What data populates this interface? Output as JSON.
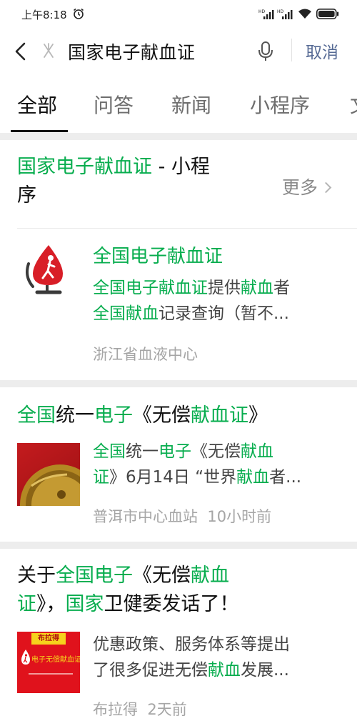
{
  "status_bar": {
    "time": "上午8:18",
    "signal1_label": "HD",
    "signal2_label": "HD"
  },
  "search": {
    "query": "国家电子献血证",
    "cancel_label": "取消"
  },
  "tabs": [
    {
      "label": "全部",
      "active": true
    },
    {
      "label": "问答",
      "active": false
    },
    {
      "label": "新闻",
      "active": false
    },
    {
      "label": "小程序",
      "active": false
    },
    {
      "label": "文",
      "active": false
    }
  ],
  "mini_program_section": {
    "title_highlight": "国家电子献血证",
    "title_rest_line1": " - 小程",
    "title_line2": "序",
    "more_label": "更多",
    "item": {
      "name": "全国电子献血证",
      "snippet_line1": [
        {
          "text": "全国电子献血证",
          "hl": true
        },
        {
          "text": "提供",
          "hl": false
        },
        {
          "text": "献血",
          "hl": true
        },
        {
          "text": "者",
          "hl": false
        }
      ],
      "snippet_line2": [
        {
          "text": "全国献血",
          "hl": true
        },
        {
          "text": "记录查询（暂不...",
          "hl": false
        }
      ],
      "source": "浙江省血液中心"
    }
  },
  "articles": [
    {
      "title_lines": [
        [
          {
            "text": "全国",
            "hl": true
          },
          {
            "text": "统一",
            "hl": false
          },
          {
            "text": "电子",
            "hl": true
          },
          {
            "text": "《无偿",
            "hl": false
          },
          {
            "text": "献血证",
            "hl": true
          },
          {
            "text": "》",
            "hl": false
          }
        ]
      ],
      "snippet_lines": [
        [
          {
            "text": "全国",
            "hl": true
          },
          {
            "text": "统一",
            "hl": false
          },
          {
            "text": "电子",
            "hl": true
          },
          {
            "text": "《无偿",
            "hl": false
          },
          {
            "text": "献血",
            "hl": true
          }
        ],
        [
          {
            "text": "证",
            "hl": true
          },
          {
            "text": "》6月14日 “世界",
            "hl": false
          },
          {
            "text": "献血",
            "hl": true
          },
          {
            "text": "者...",
            "hl": false
          }
        ]
      ],
      "source": "普洱市中心血站",
      "time": "10小时前"
    },
    {
      "title_lines": [
        [
          {
            "text": "关于",
            "hl": false
          },
          {
            "text": "全国电子",
            "hl": true
          },
          {
            "text": "《无偿",
            "hl": false
          },
          {
            "text": "献血",
            "hl": true
          }
        ],
        [
          {
            "text": "证",
            "hl": true
          },
          {
            "text": "》，",
            "hl": false
          },
          {
            "text": "国家",
            "hl": true
          },
          {
            "text": "卫健委发话了！",
            "hl": false
          }
        ]
      ],
      "snippet_lines": [
        [
          {
            "text": "优惠政策、服务体系等提出",
            "hl": false
          }
        ],
        [
          {
            "text": "了很多促进无偿",
            "hl": false
          },
          {
            "text": "献血",
            "hl": true
          },
          {
            "text": "发展...",
            "hl": false
          }
        ]
      ],
      "thumb_brand": "布拉得",
      "thumb_caption": "电子无偿献血证",
      "source": "布拉得",
      "time": "2天前"
    }
  ],
  "colors": {
    "highlight": "#07ad4e",
    "link_blue": "#576b95",
    "gap_gray": "#ededed"
  }
}
